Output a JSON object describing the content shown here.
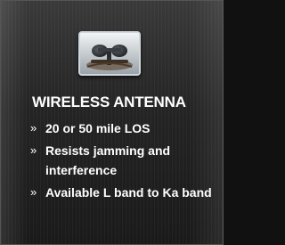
{
  "product": {
    "image_icon": "antenna-photo",
    "title": "WIRELESS ANTENNA",
    "bullet_mark": "»",
    "features": [
      "20 or 50 mile LOS",
      "Resists jamming and interference",
      "Available L band to Ka band"
    ]
  },
  "colors": {
    "text": "#ffffff",
    "panel": "#2a2a2a"
  }
}
